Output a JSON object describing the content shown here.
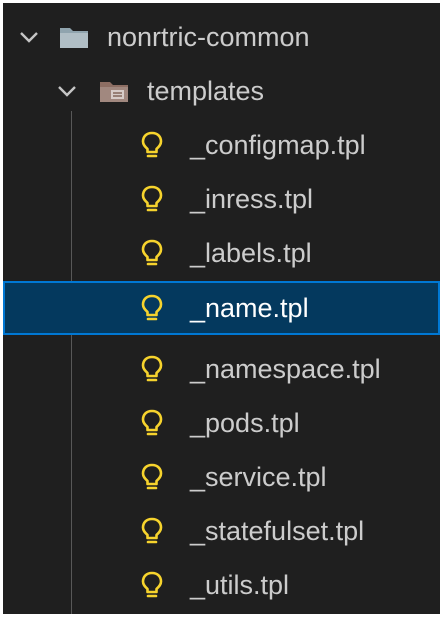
{
  "explorer": {
    "root_folder": {
      "label": "nonrtric-common",
      "icon": "folder-icon",
      "expanded": true
    },
    "sub_folder": {
      "label": "templates",
      "icon": "templates-folder-icon",
      "expanded": true
    },
    "files": [
      {
        "label": "_configmap.tpl",
        "icon": "lightbulb-icon",
        "selected": false
      },
      {
        "label": "_inress.tpl",
        "icon": "lightbulb-icon",
        "selected": false
      },
      {
        "label": "_labels.tpl",
        "icon": "lightbulb-icon",
        "selected": false
      },
      {
        "label": "_name.tpl",
        "icon": "lightbulb-icon",
        "selected": true
      },
      {
        "label": "_namespace.tpl",
        "icon": "lightbulb-icon",
        "selected": false
      },
      {
        "label": "_pods.tpl",
        "icon": "lightbulb-icon",
        "selected": false
      },
      {
        "label": "_service.tpl",
        "icon": "lightbulb-icon",
        "selected": false
      },
      {
        "label": "_statefulset.tpl",
        "icon": "lightbulb-icon",
        "selected": false
      },
      {
        "label": "_utils.tpl",
        "icon": "lightbulb-icon",
        "selected": false
      }
    ]
  },
  "colors": {
    "background": "#1f1f1f",
    "selection": "#04395e",
    "selection_border": "#0078d4",
    "file_icon": "#f6d32d",
    "text": "#cccccc"
  }
}
